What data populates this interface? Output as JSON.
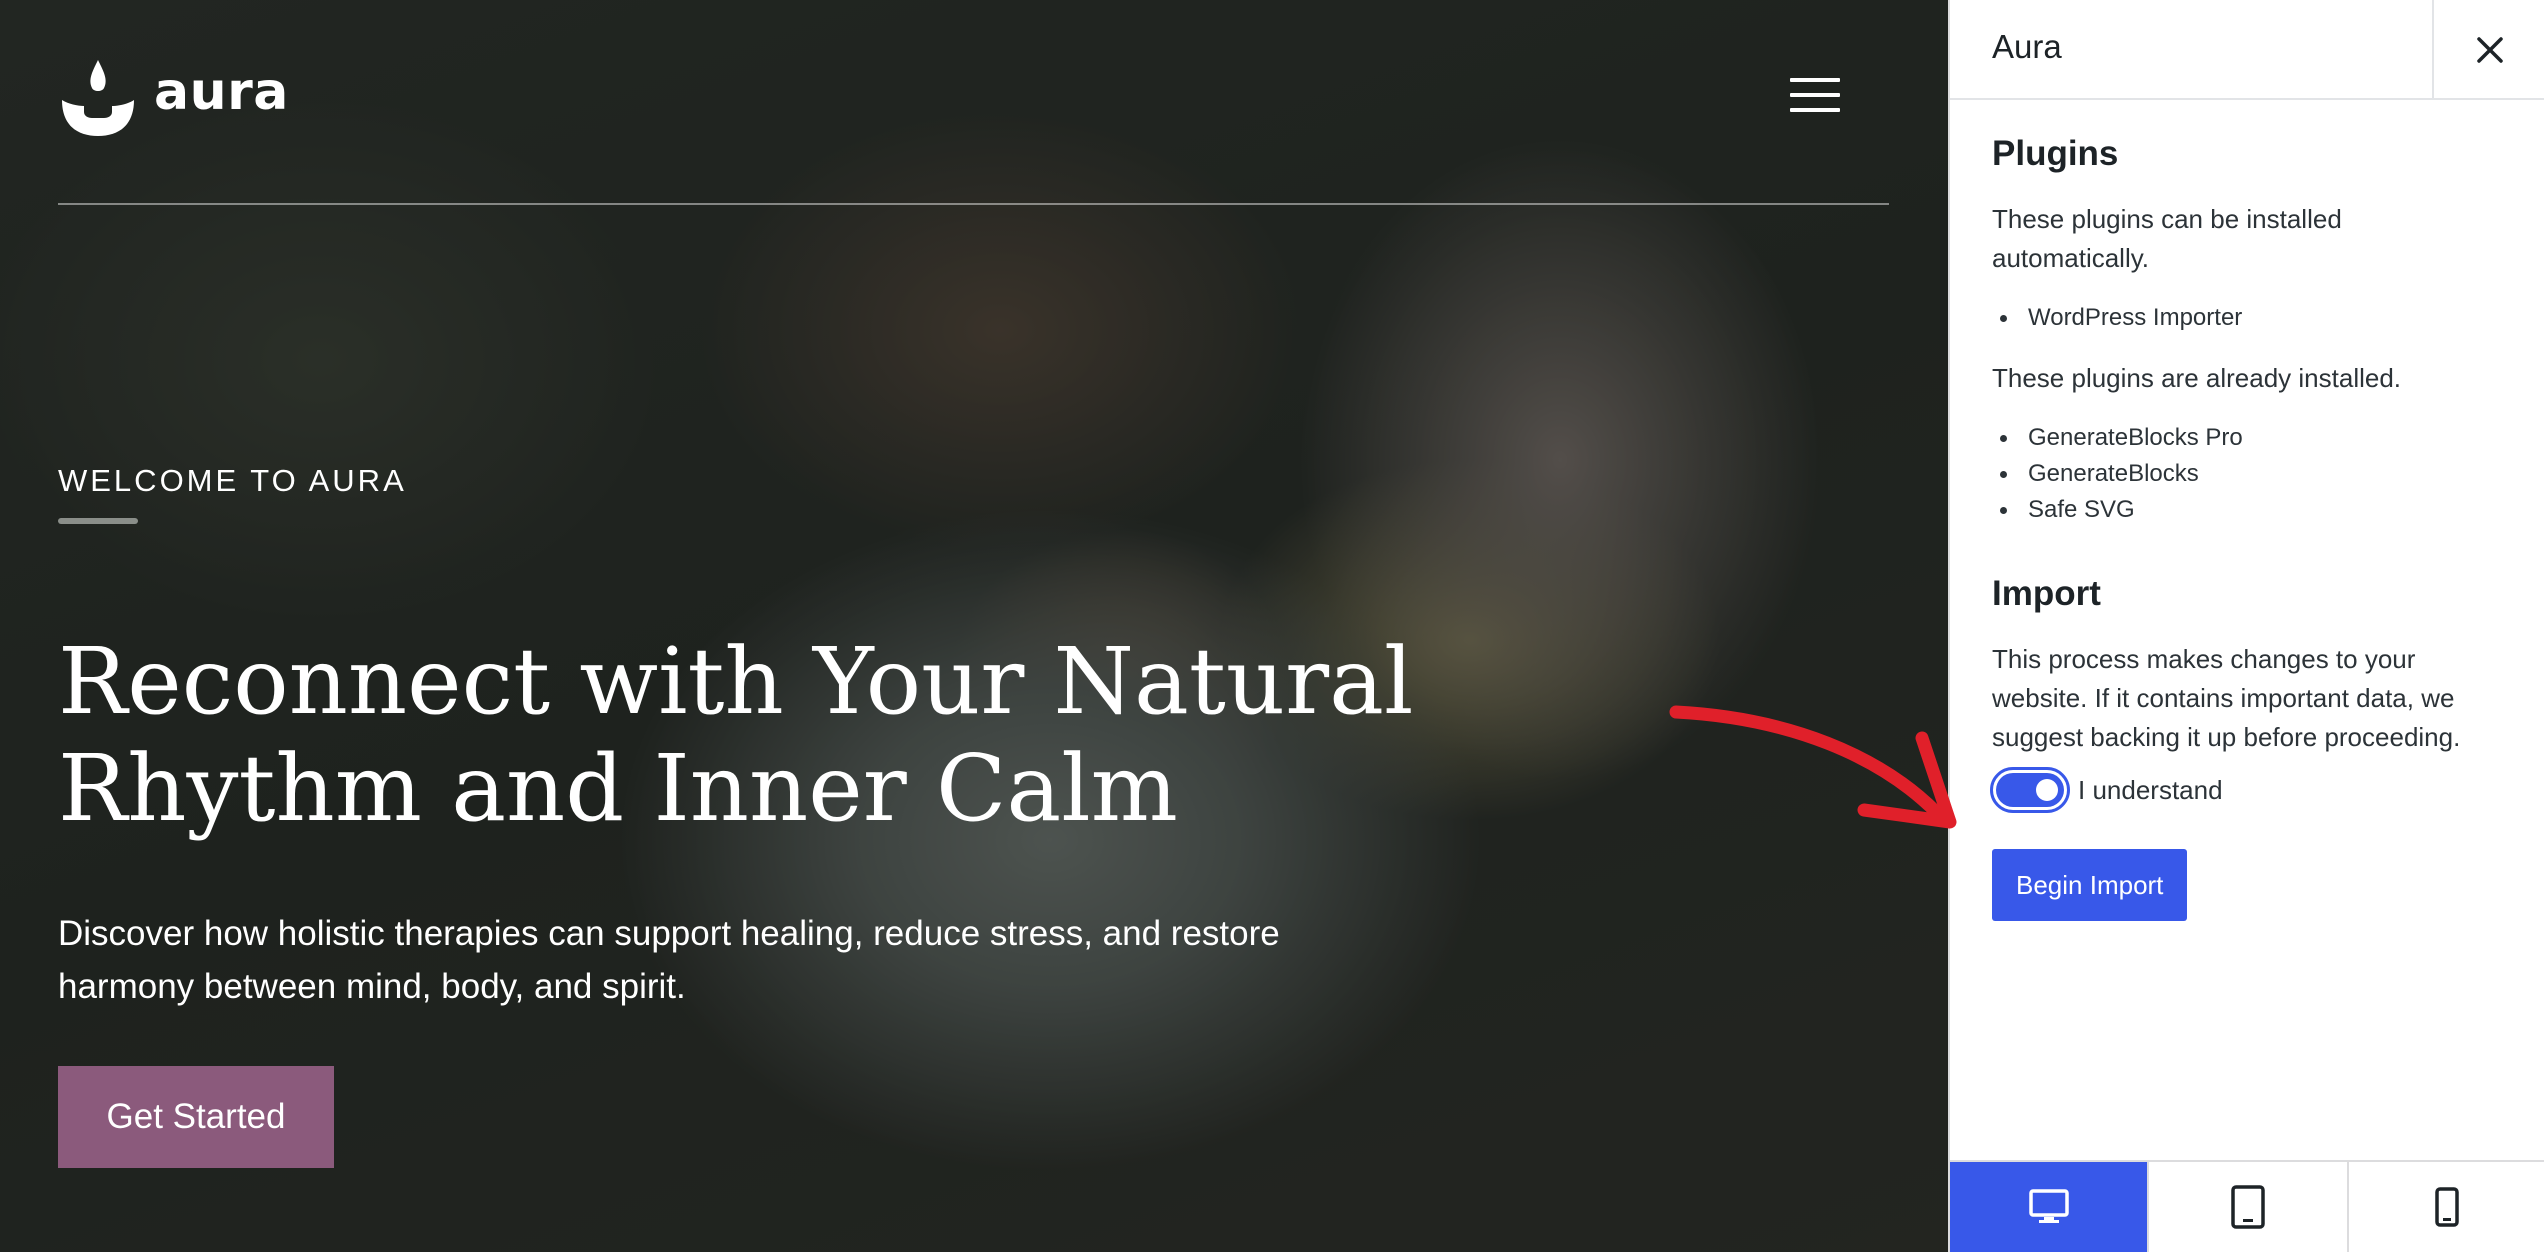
{
  "preview": {
    "logo_text": "aura",
    "kicker": "WELCOME TO AURA",
    "headline_line1": "Reconnect with Your Natural",
    "headline_line2": "Rhythm and Inner Calm",
    "subtext_line1": "Discover how holistic therapies can support healing, reduce stress, and restore",
    "subtext_line2": "harmony between mind, body, and spirit.",
    "cta_label": "Get Started",
    "cta_color": "#8b5a7c"
  },
  "sidebar": {
    "title": "Aura",
    "plugins": {
      "heading": "Plugins",
      "auto_text_line1": "These plugins can be installed",
      "auto_text_line2": "automatically.",
      "auto_items": [
        "WordPress Importer"
      ],
      "installed_text": "These plugins are already installed.",
      "installed_items": [
        "GenerateBlocks Pro",
        "GenerateBlocks",
        "Safe SVG"
      ]
    },
    "import": {
      "heading": "Import",
      "warning_line1": "This process makes changes to your",
      "warning_line2": "website. If it contains important data, we",
      "warning_line3": "suggest backing it up before proceeding.",
      "toggle_label": "I understand",
      "toggle_on": true,
      "button_label": "Begin Import"
    },
    "devices": [
      {
        "icon": "desktop-icon",
        "active": true
      },
      {
        "icon": "tablet-icon",
        "active": false
      },
      {
        "icon": "mobile-icon",
        "active": false
      }
    ]
  },
  "colors": {
    "accent": "#3858e9",
    "arrow": "#e0202a"
  }
}
